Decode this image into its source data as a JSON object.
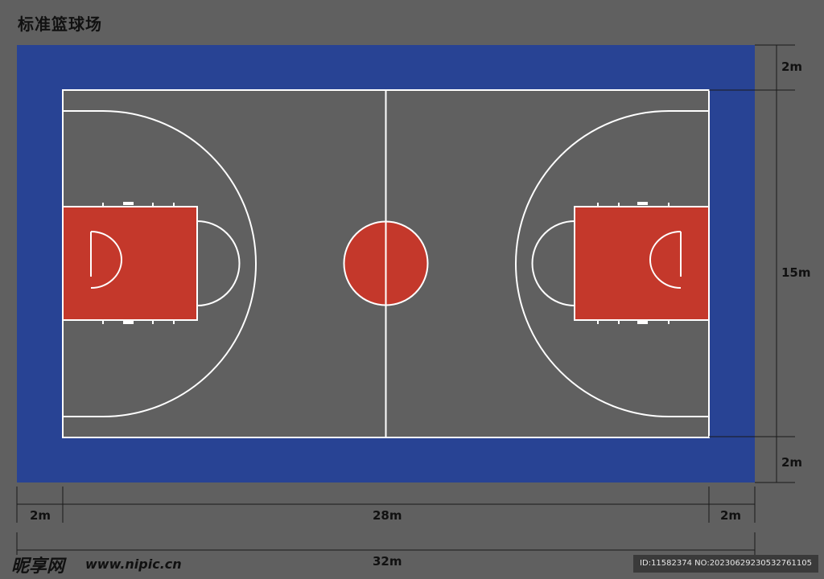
{
  "title": "标准篮球场",
  "colors": {
    "background": "#606060",
    "border": "#284394",
    "court_floor": "#606060",
    "key_paint": "#c4382b",
    "lines": "#ffffff"
  },
  "dimensions": {
    "top_border": "2m",
    "court_width": "15m",
    "bottom_border": "2m",
    "left_border": "2m",
    "court_length": "28m",
    "right_border": "2m",
    "total_length": "32m"
  },
  "watermark": {
    "logo": "昵享网",
    "site": "www.nipic.cn",
    "id_text": "ID:11582374 NO:20230629230532761105"
  }
}
